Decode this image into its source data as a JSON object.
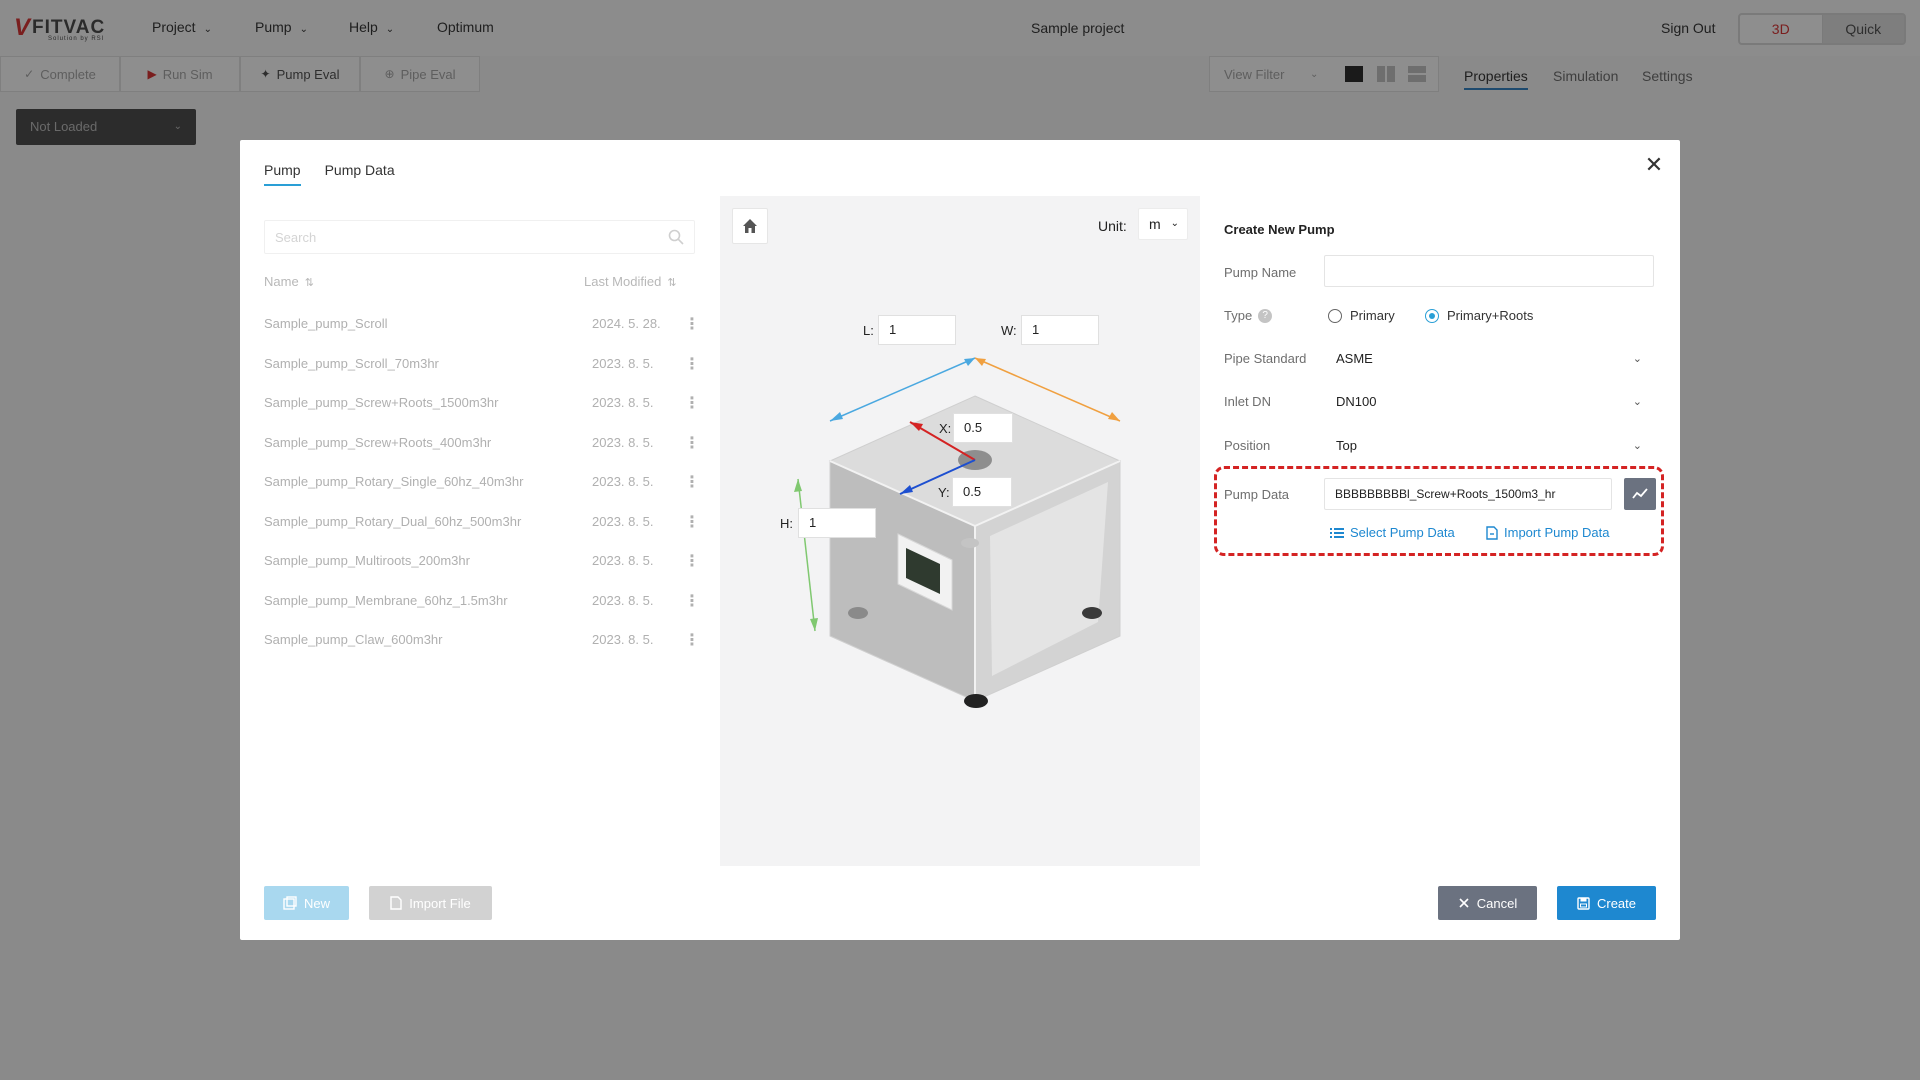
{
  "app": {
    "logo_text": "FITVAC",
    "logo_sub": "Solution by RSI",
    "menu": [
      {
        "label": "Project"
      },
      {
        "label": "Pump"
      },
      {
        "label": "Help"
      },
      {
        "label": "Optimum"
      }
    ],
    "project_title": "Sample project",
    "sign_out": "Sign Out",
    "mode_3d": "3D",
    "mode_quick": "Quick"
  },
  "toolbar": {
    "complete": "Complete",
    "run_sim": "Run Sim",
    "pump_eval": "Pump Eval",
    "pipe_eval": "Pipe Eval",
    "view_filter": "View Filter"
  },
  "right_tabs": {
    "properties": "Properties",
    "simulation": "Simulation",
    "settings": "Settings"
  },
  "not_loaded": "Not Loaded",
  "modal": {
    "tabs": [
      "Pump",
      "Pump Data"
    ],
    "search_placeholder": "Search",
    "list_header": {
      "name": "Name",
      "modified": "Last Modified"
    },
    "pumps": [
      {
        "name": "Sample_pump_Scroll",
        "date": "2024. 5. 28."
      },
      {
        "name": "Sample_pump_Scroll_70m3hr",
        "date": "2023. 8. 5."
      },
      {
        "name": "Sample_pump_Screw+Roots_1500m3hr",
        "date": "2023. 8. 5."
      },
      {
        "name": "Sample_pump_Screw+Roots_400m3hr",
        "date": "2023. 8. 5."
      },
      {
        "name": "Sample_pump_Rotary_Single_60hz_40m3hr",
        "date": "2023. 8. 5."
      },
      {
        "name": "Sample_pump_Rotary_Dual_60hz_500m3hr",
        "date": "2023. 8. 5."
      },
      {
        "name": "Sample_pump_Multiroots_200m3hr",
        "date": "2023. 8. 5."
      },
      {
        "name": "Sample_pump_Membrane_60hz_1.5m3hr",
        "date": "2023. 8. 5."
      },
      {
        "name": "Sample_pump_Claw_600m3hr",
        "date": "2023. 8. 5."
      }
    ],
    "viewport": {
      "unit_label": "Unit:",
      "unit_value": "m",
      "L_label": "L:",
      "L": "1",
      "W_label": "W:",
      "W": "1",
      "H_label": "H:",
      "H": "1",
      "X_label": "X:",
      "X": "0.5",
      "Y_label": "Y:",
      "Y": "0.5"
    },
    "form": {
      "title": "Create New Pump",
      "pump_name_label": "Pump Name",
      "pump_name_value": "",
      "type_label": "Type",
      "type_help": "?",
      "type_primary": "Primary",
      "type_primary_roots": "Primary+Roots",
      "pipe_standard_label": "Pipe Standard",
      "pipe_standard_value": "ASME",
      "inlet_dn_label": "Inlet DN",
      "inlet_dn_value": "DN100",
      "position_label": "Position",
      "position_value": "Top",
      "pump_data_label": "Pump Data",
      "pump_data_value": "BBBBBBBBBl_Screw+Roots_1500m3_hr",
      "select_pump_data": "Select Pump Data",
      "import_pump_data": "Import Pump Data"
    },
    "buttons": {
      "new": "New",
      "import_file": "Import File",
      "cancel": "Cancel",
      "create": "Create"
    }
  },
  "colors": {
    "accent": "#1e88d0",
    "highlight_dash": "#d42323",
    "overlay": "#8a8a8a"
  }
}
